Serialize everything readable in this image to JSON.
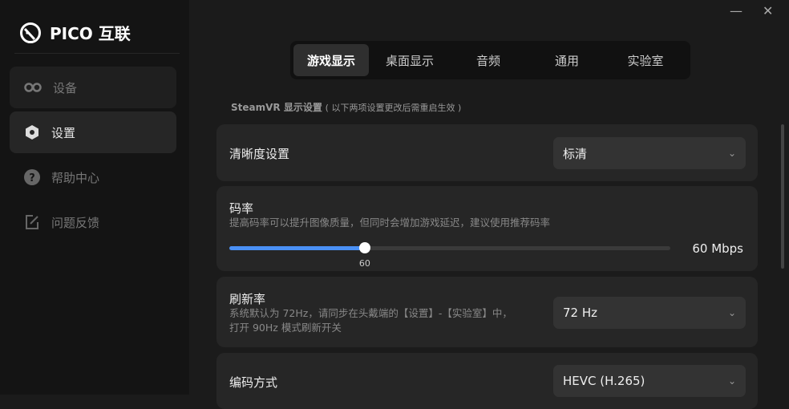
{
  "app": {
    "brand": "PICO 互联"
  },
  "sidebar": {
    "items": [
      {
        "label": "设备"
      },
      {
        "label": "设置"
      },
      {
        "label": "帮助中心"
      },
      {
        "label": "问题反馈"
      }
    ]
  },
  "window": {
    "minimize": "—",
    "close": "✕"
  },
  "tabs": [
    {
      "label": "游戏显示"
    },
    {
      "label": "桌面显示"
    },
    {
      "label": "音频"
    },
    {
      "label": "通用"
    },
    {
      "label": "实验室"
    }
  ],
  "section": {
    "title": "SteamVR 显示设置",
    "note": "( 以下两项设置更改后需重启生效 )"
  },
  "clarity": {
    "title": "清晰度设置",
    "value": "标清"
  },
  "bitrate": {
    "title": "码率",
    "desc": "提高码率可以提升图像质量，但同时会增加游戏延迟，建议使用推荐码率",
    "slider_value": "60",
    "slider_fill_percent": 30.7,
    "readout": "60 Mbps",
    "accent": "#4a90f5"
  },
  "refresh": {
    "title": "刷新率",
    "desc1": "系统默认为 72Hz，请同步在头戴端的【设置】-【实验室】中，",
    "desc2": "打开 90Hz 模式刷新开关",
    "value": "72 Hz"
  },
  "encoding": {
    "title": "编码方式",
    "value": "HEVC (H.265)"
  }
}
